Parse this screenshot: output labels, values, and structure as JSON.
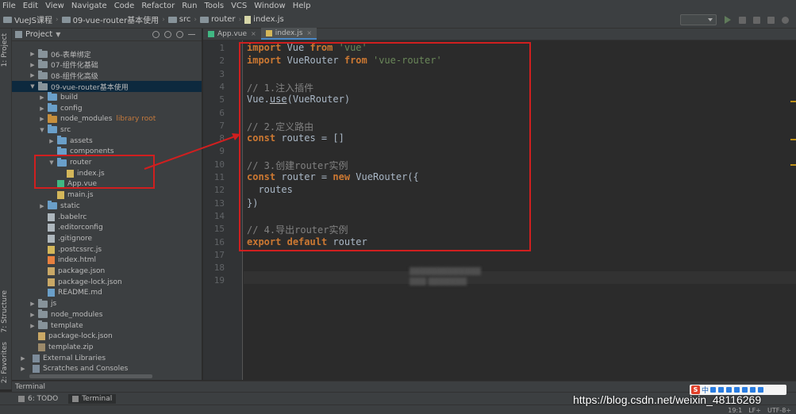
{
  "menubar": [
    "File",
    "Edit",
    "View",
    "Navigate",
    "Code",
    "Refactor",
    "Run",
    "Tools",
    "VCS",
    "Window",
    "Help"
  ],
  "breadcrumb": [
    "VueJS课程",
    "09-vue-router基本使用",
    "src",
    "router",
    "index.js"
  ],
  "left_stripe": [
    "1: Project",
    "7: Structure",
    "2: Favorites"
  ],
  "project": {
    "title": "Project",
    "tree": [
      {
        "label": "06-表单绑定",
        "kind": "folder",
        "expanded": false
      },
      {
        "label": "07-组件化基础",
        "kind": "folder",
        "expanded": false
      },
      {
        "label": "08-组件化高级",
        "kind": "folder",
        "expanded": false
      },
      {
        "label": "09-vue-router基本使用",
        "kind": "folder",
        "expanded": true,
        "selected": true
      },
      {
        "label": "build",
        "kind": "folder",
        "expanded": false
      },
      {
        "label": "config",
        "kind": "folder",
        "expanded": false
      },
      {
        "label": "node_modules",
        "kind": "folder-orange",
        "expanded": false,
        "suffix": "library root"
      },
      {
        "label": "src",
        "kind": "folder",
        "expanded": true
      },
      {
        "label": "assets",
        "kind": "folder",
        "expanded": false
      },
      {
        "label": "components",
        "kind": "folder",
        "expanded": null
      },
      {
        "label": "router",
        "kind": "folder",
        "expanded": true
      },
      {
        "label": "index.js",
        "kind": "js"
      },
      {
        "label": "App.vue",
        "kind": "vue"
      },
      {
        "label": "main.js",
        "kind": "js"
      },
      {
        "label": "static",
        "kind": "folder",
        "expanded": false
      },
      {
        "label": ".babelrc",
        "kind": "file"
      },
      {
        "label": ".editorconfig",
        "kind": "file"
      },
      {
        "label": ".gitignore",
        "kind": "file"
      },
      {
        "label": ".postcssrc.js",
        "kind": "js"
      },
      {
        "label": "index.html",
        "kind": "html"
      },
      {
        "label": "package.json",
        "kind": "json"
      },
      {
        "label": "package-lock.json",
        "kind": "json"
      },
      {
        "label": "README.md",
        "kind": "md"
      },
      {
        "label": "js",
        "kind": "folder",
        "expanded": false
      },
      {
        "label": "node_modules",
        "kind": "folder",
        "expanded": false
      },
      {
        "label": "template",
        "kind": "folder",
        "expanded": false
      },
      {
        "label": "package-lock.json",
        "kind": "json"
      },
      {
        "label": "template.zip",
        "kind": "zip"
      },
      {
        "label": "External Libraries",
        "kind": "lib",
        "expanded": false
      },
      {
        "label": "Scratches and Consoles",
        "kind": "lib",
        "expanded": false
      }
    ]
  },
  "tabs": [
    {
      "label": "App.vue",
      "active": false
    },
    {
      "label": "index.js",
      "active": true
    }
  ],
  "editor": {
    "lines": [
      [
        {
          "t": "import",
          "c": "kw"
        },
        {
          "t": " Vue "
        },
        {
          "t": "from",
          "c": "kw"
        },
        {
          "t": " "
        },
        {
          "t": "'vue'",
          "c": "str"
        }
      ],
      [
        {
          "t": "import",
          "c": "kw"
        },
        {
          "t": " VueRouter "
        },
        {
          "t": "from",
          "c": "kw"
        },
        {
          "t": " "
        },
        {
          "t": "'vue-router'",
          "c": "str"
        }
      ],
      [],
      [
        {
          "t": "// 1.注入插件",
          "c": "cmt"
        }
      ],
      [
        {
          "t": "Vue."
        },
        {
          "t": "use",
          "c": "fn"
        },
        {
          "t": "(VueRouter)"
        }
      ],
      [],
      [
        {
          "t": "// 2.定义路由",
          "c": "cmt"
        }
      ],
      [
        {
          "t": "const",
          "c": "kw"
        },
        {
          "t": " routes = []"
        }
      ],
      [],
      [
        {
          "t": "// 3.创建router实例",
          "c": "cmt"
        }
      ],
      [
        {
          "t": "const",
          "c": "kw"
        },
        {
          "t": " router = "
        },
        {
          "t": "new",
          "c": "kw"
        },
        {
          "t": " VueRouter({"
        }
      ],
      [
        {
          "t": "  routes"
        }
      ],
      [
        {
          "t": "})"
        }
      ],
      [],
      [
        {
          "t": "// 4.导出router实例",
          "c": "cmt"
        }
      ],
      [
        {
          "t": "export",
          "c": "kw"
        },
        {
          "t": " "
        },
        {
          "t": "default",
          "c": "kw"
        },
        {
          "t": " router"
        }
      ],
      [],
      [],
      []
    ]
  },
  "bottom": {
    "terminal_title": "Terminal",
    "tabs": [
      "6: TODO",
      "Terminal"
    ],
    "status": [
      "19:1",
      "LF÷",
      "UTF-8÷"
    ]
  },
  "ime": {
    "logo": "S",
    "label": "中"
  },
  "watermark": "https://blog.csdn.net/weixin_48116269"
}
